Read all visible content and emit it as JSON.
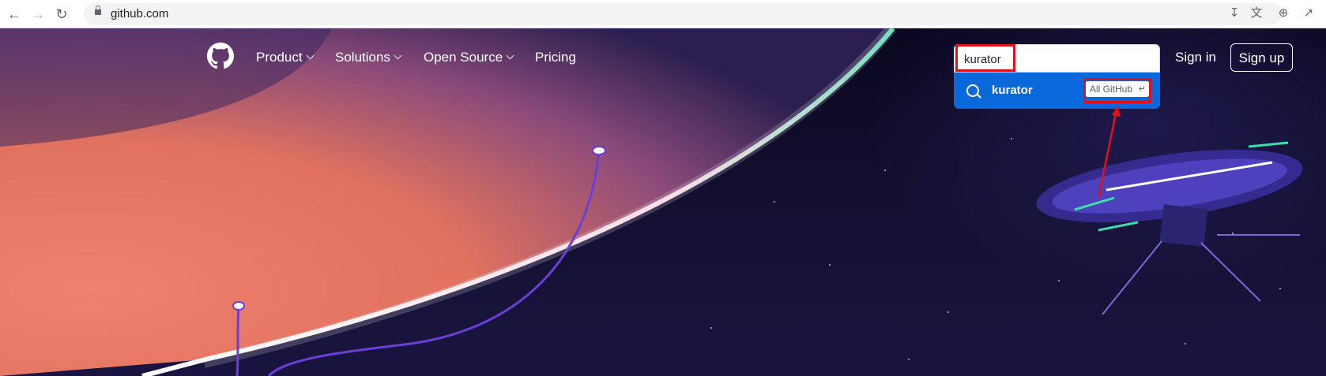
{
  "browser": {
    "back_icon": "arrow-left-icon",
    "forward_icon": "arrow-right-icon",
    "reload_icon": "reload-icon",
    "url": "github.com",
    "toolbar_icons": [
      "download-icon",
      "translate-icon",
      "zoom-icon",
      "share-icon"
    ]
  },
  "header": {
    "logo_icon": "github-logo-icon",
    "nav": [
      {
        "label": "Product",
        "has_dropdown": true
      },
      {
        "label": "Solutions",
        "has_dropdown": true
      },
      {
        "label": "Open Source",
        "has_dropdown": true
      },
      {
        "label": "Pricing",
        "has_dropdown": false
      }
    ],
    "search": {
      "value": "kurator",
      "suggestion": {
        "text": "kurator",
        "scope_badge": "All GitHub",
        "enter_glyph": "↵"
      }
    },
    "sign_in": "Sign in",
    "sign_up": "Sign up"
  },
  "colors": {
    "annotation": "#e0101d",
    "suggestion_bg": "#0969da",
    "hero_bg": "#0d0b24"
  }
}
